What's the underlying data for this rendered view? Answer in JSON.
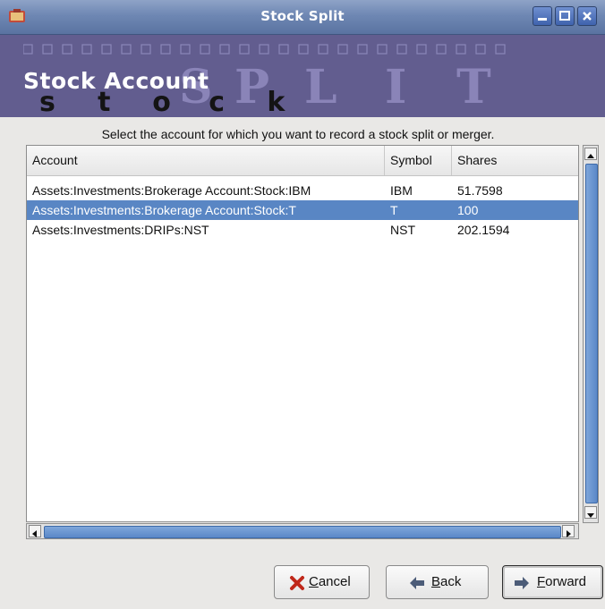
{
  "window": {
    "title": "Stock Split"
  },
  "banner": {
    "page_title": "Stock Account",
    "stock_letters": [
      "s",
      "t",
      "o",
      "c",
      "k"
    ],
    "split_letters": [
      "S",
      "P",
      "L",
      "I",
      "T"
    ]
  },
  "instructions": "Select the account for which you want to record a stock split or merger.",
  "table": {
    "columns": {
      "account": "Account",
      "symbol": "Symbol",
      "shares": "Shares"
    },
    "rows": [
      {
        "account": "Assets:Investments:Brokerage Account:Stock:IBM",
        "symbol": "IBM",
        "shares": "51.7598",
        "selected": false
      },
      {
        "account": "Assets:Investments:Brokerage Account:Stock:T",
        "symbol": "T",
        "shares": "100",
        "selected": true
      },
      {
        "account": "Assets:Investments:DRIPs:NST",
        "symbol": "NST",
        "shares": "202.1594",
        "selected": false
      }
    ]
  },
  "buttons": {
    "cancel": {
      "mnemonic": "C",
      "rest": "ancel"
    },
    "back": {
      "mnemonic": "B",
      "rest": "ack"
    },
    "forward": {
      "mnemonic": "F",
      "rest": "orward"
    }
  },
  "colors": {
    "titlebar": "#6e87b3",
    "banner": "#625d8f",
    "selection": "#5986c4"
  },
  "icons": {
    "cancel": "red-x-icon",
    "back": "left-arrow-icon",
    "forward": "right-arrow-icon"
  }
}
